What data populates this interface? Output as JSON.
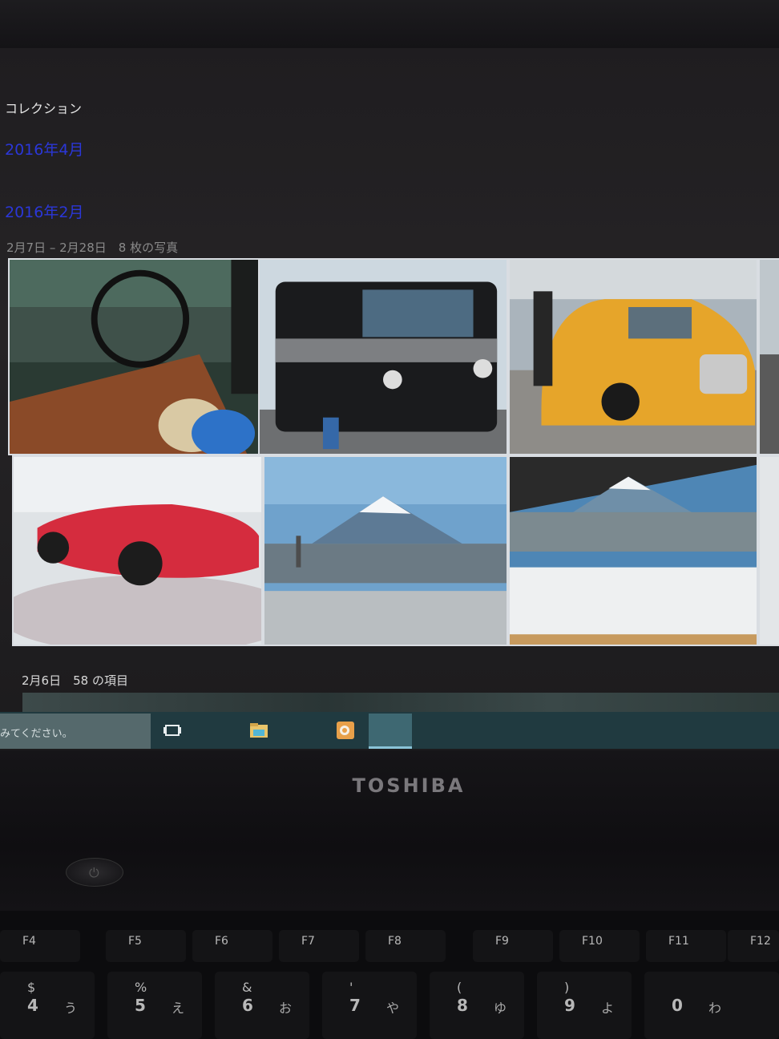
{
  "photos_app": {
    "section_title": "コレクション",
    "months": [
      "2016年4月",
      "2016年2月"
    ],
    "group1_meta": "2月7日 – 2月28日　8 枚の写真",
    "group2_meta": "2月6日　58 の項目"
  },
  "taskbar": {
    "search_placeholder": "みてください。",
    "icons": [
      "task-view-icon",
      "file-explorer-icon",
      "outlook-icon"
    ]
  },
  "laptop": {
    "brand": "TOSHIBA",
    "function_keys": [
      "F4",
      "F5",
      "F6",
      "F7",
      "F8",
      "F9",
      "F10",
      "F11",
      "F12"
    ],
    "number_keys": [
      {
        "sym": "$",
        "num": "4",
        "kana": "う"
      },
      {
        "sym": "%",
        "num": "5",
        "kana": "え"
      },
      {
        "sym": "&",
        "num": "6",
        "kana": "お"
      },
      {
        "sym": "'",
        "num": "7",
        "kana": "や"
      },
      {
        "sym": "(",
        "num": "8",
        "kana": "ゆ"
      },
      {
        "sym": ")",
        "num": "9",
        "kana": "よ"
      },
      {
        "sym": "",
        "num": "0",
        "kana": "わ"
      }
    ]
  },
  "colors": {
    "link_blue": "#2b37d8",
    "taskbar": "#203a40",
    "screen_bg": "#222022"
  }
}
